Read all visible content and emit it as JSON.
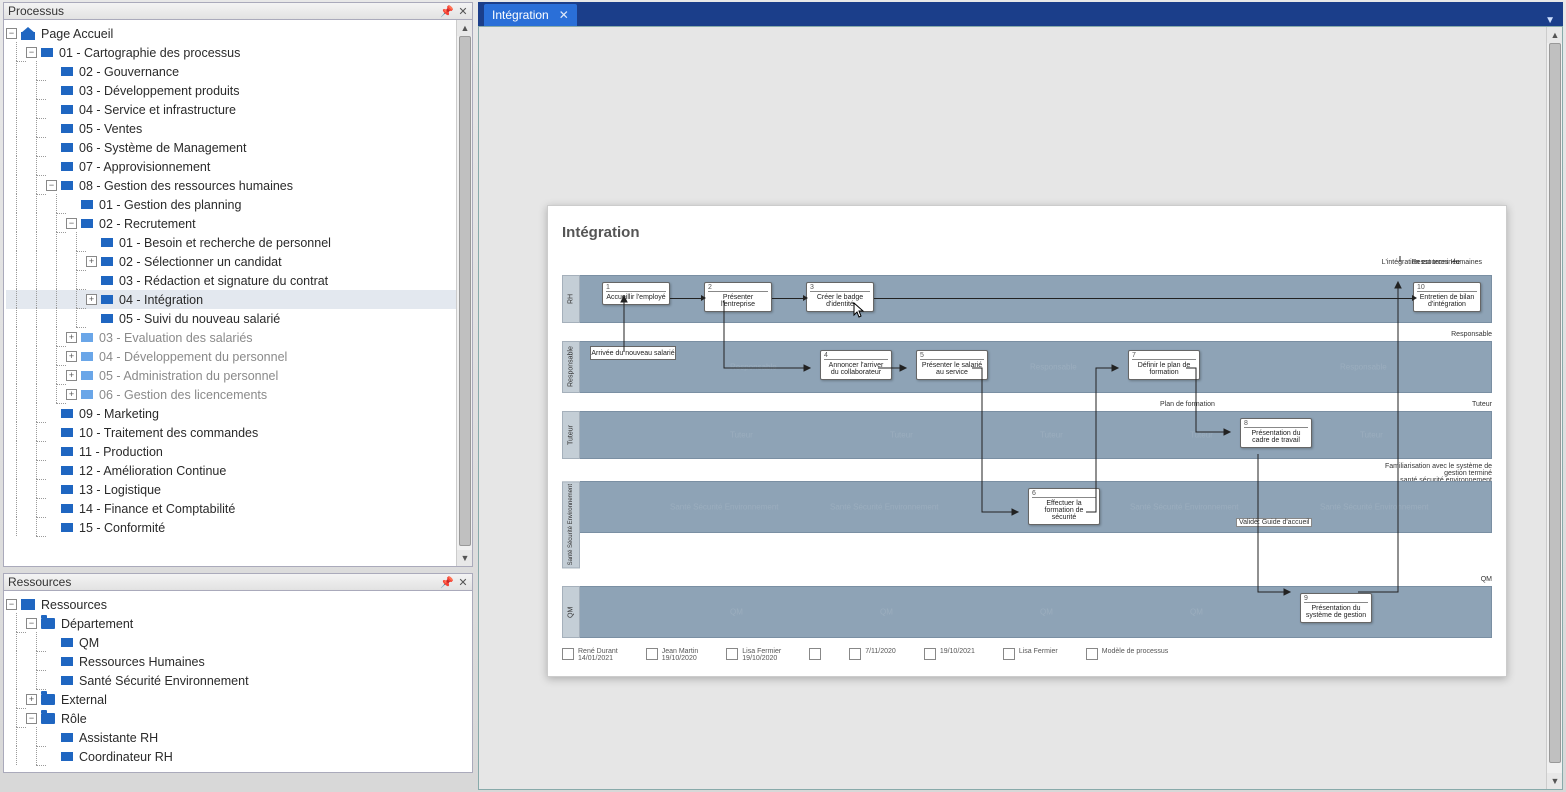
{
  "panels": {
    "processus": {
      "title": "Processus"
    },
    "ressources": {
      "title": "Ressources"
    }
  },
  "tree": {
    "root": "Page Accueil",
    "n01": "01 - Cartographie des processus",
    "items_top": [
      "02 - Gouvernance",
      "03 - Développement produits",
      "04 - Service et infrastructure",
      "05 - Ventes",
      "06 - Système de Management",
      "07 - Approvisionnement"
    ],
    "n08": "08 - Gestion des ressources humaines",
    "n08_children_pre": [
      "01 - Gestion des planning"
    ],
    "n08_02": "02 - Recrutement",
    "n08_02_children": [
      "01 - Besoin et recherche de personnel",
      "02 - Sélectionner un candidat",
      "03 - Rédaction et signature du contrat",
      "04 - Intégration",
      "05 - Suivi du nouveau salarié"
    ],
    "n08_grey": [
      "03 - Evaluation des salariés",
      "04 - Développement du personnel",
      "05 - Administration du personnel",
      "06 - Gestion des licencements"
    ],
    "items_bottom": [
      "09 - Marketing",
      "10 - Traitement des commandes",
      "11 - Production",
      "12 - Amélioration Continue",
      "13 - Logistique",
      "14 - Finance et Comptabilité",
      "15 - Conformité"
    ]
  },
  "resources": {
    "root": "Ressources",
    "dept": "Département",
    "dept_items": [
      "QM",
      "Ressources Humaines",
      "Santé Sécurité Environnement"
    ],
    "external": "External",
    "role": "Rôle",
    "role_items": [
      "Assistante RH",
      "Coordinateur RH"
    ]
  },
  "tab": {
    "title": "Intégration"
  },
  "diagram": {
    "title": "Intégration",
    "end_note": "L'intégration est terminée",
    "end_lane_note": "Ressources Humaines",
    "lanes": {
      "rh": "RH",
      "responsable": "Responsable",
      "tuteur": "Tuteur",
      "sse": "Santé Sécurité Environnement",
      "qm": "QM"
    },
    "lane_side_labels": {
      "responsable": "Responsable",
      "tuteur": "Tuteur",
      "sse": "santé sécurité environnement",
      "qm": "QM"
    },
    "tasks": {
      "t1": {
        "n": "1",
        "label": "Accueillir l'employé"
      },
      "t2": {
        "n": "2",
        "label": "Présenter l'entreprise"
      },
      "t3": {
        "n": "3",
        "label": "Créer le badge d'identité"
      },
      "t10": {
        "n": "10",
        "label": "Entretien de bilan d'intégration"
      },
      "t4": {
        "n": "4",
        "label": "Annoncer l'arriver du collaborateur"
      },
      "t5": {
        "n": "5",
        "label": "Présenter le salarié au service"
      },
      "t7": {
        "n": "7",
        "label": "Définir le plan de formation"
      },
      "t8": {
        "n": "8",
        "label": "Présentation du cadre de travail"
      },
      "t6": {
        "n": "6",
        "label": "Effectuer la formation de sécurité"
      },
      "t9": {
        "n": "9",
        "label": "Présentation du système de gestion"
      }
    },
    "start_event": "Arrivée du nouveau salarié",
    "notes": {
      "plan": "Plan de formation",
      "famil": "Familiarisation avec le système de gestion terminé",
      "valide": "Validé: Guide d'accueil"
    },
    "watermarks": {
      "responsable": "Responsable",
      "tuteur": "Tuteur",
      "sse": "Santé Sécurité Environnement",
      "qm": "QM"
    },
    "footer": [
      {
        "name": "René Durant",
        "date": "14/01/2021"
      },
      {
        "name": "Jean Martin",
        "date": "19/10/2020"
      },
      {
        "name": "Lisa Fermier",
        "date": "19/10/2020"
      },
      {
        "name": "",
        "date": ""
      },
      {
        "name": "7/11/2020",
        "date": ""
      },
      {
        "name": "19/10/2021",
        "date": ""
      },
      {
        "name": "Lisa Fermier",
        "date": ""
      },
      {
        "name": "Modèle de processus",
        "date": ""
      }
    ]
  }
}
